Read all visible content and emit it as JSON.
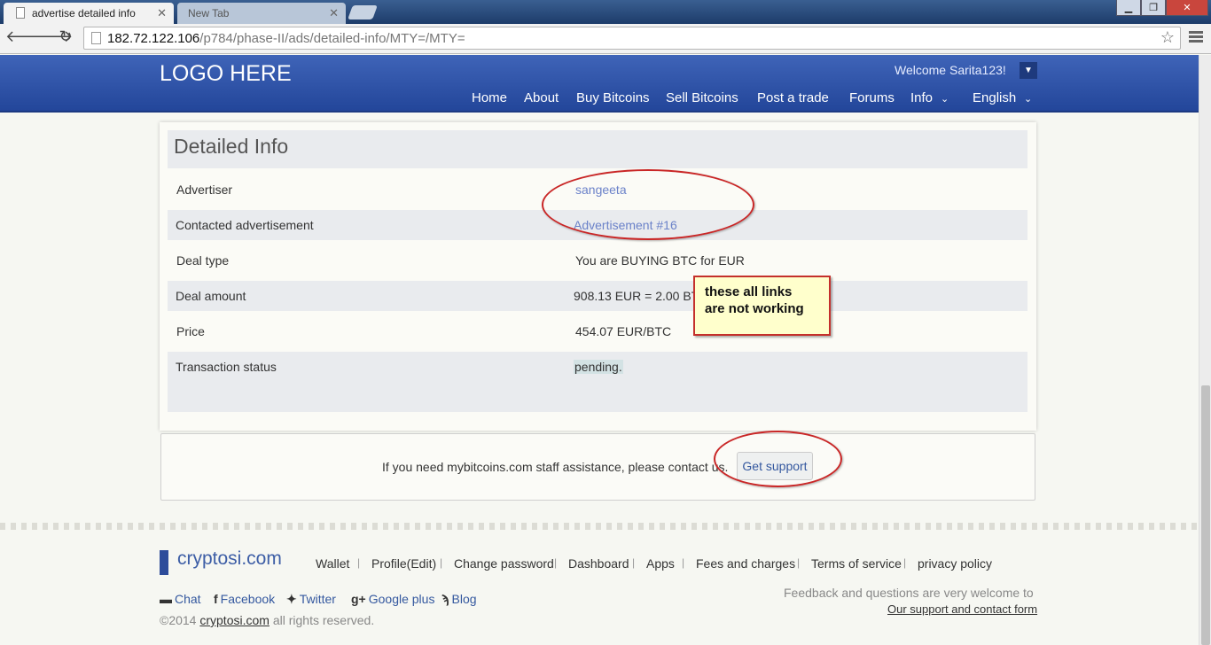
{
  "browser": {
    "active_tab_title": "advertise detailed info",
    "inactive_tab_title": "New Tab",
    "url_host": "182.72.122.106",
    "url_path": "/p784/phase-II/ads/detailed-info/MTY=/MTY="
  },
  "header": {
    "logo": "LOGO HERE",
    "welcome": "Welcome Sarita123!",
    "nav": [
      "Home",
      "About",
      "Buy Bitcoins",
      "Sell Bitcoins",
      "Post a trade",
      "Forums",
      "Info",
      "English"
    ]
  },
  "panel": {
    "title": "Detailed Info",
    "rows": [
      {
        "label": "Advertiser",
        "value": "sangeeta"
      },
      {
        "label": "Contacted advertisement",
        "value": "Advertisement #16"
      },
      {
        "label": "Deal type",
        "value": "You are BUYING BTC for EUR"
      },
      {
        "label": "Deal amount",
        "value": "908.13 EUR = 2.00 BTC"
      },
      {
        "label": "Price",
        "value": "454.07 EUR/BTC"
      },
      {
        "label": "Transaction status",
        "value": "pending."
      }
    ]
  },
  "annotation": {
    "note_line1": "these all links",
    "note_line2": "are not working"
  },
  "support": {
    "text": "If you need mybitcoins.com staff assistance, please contact us.",
    "button": "Get support"
  },
  "footer": {
    "brand": "cryptosi.com",
    "links": [
      "Wallet",
      "Profile(Edit)",
      "Change password",
      "Dashboard",
      "Apps",
      "Fees and charges",
      "Terms of service",
      "privacy policy"
    ],
    "social": [
      "Chat",
      "Facebook",
      "Twitter",
      "Google plus",
      "Blog"
    ],
    "copyright_prefix": "©2014",
    "copyright_brand": "cryptosi.com",
    "copyright_suffix": "all rights reserved.",
    "feedback": "Feedback and questions are very welcome to",
    "contact_link": "Our support and contact form"
  }
}
